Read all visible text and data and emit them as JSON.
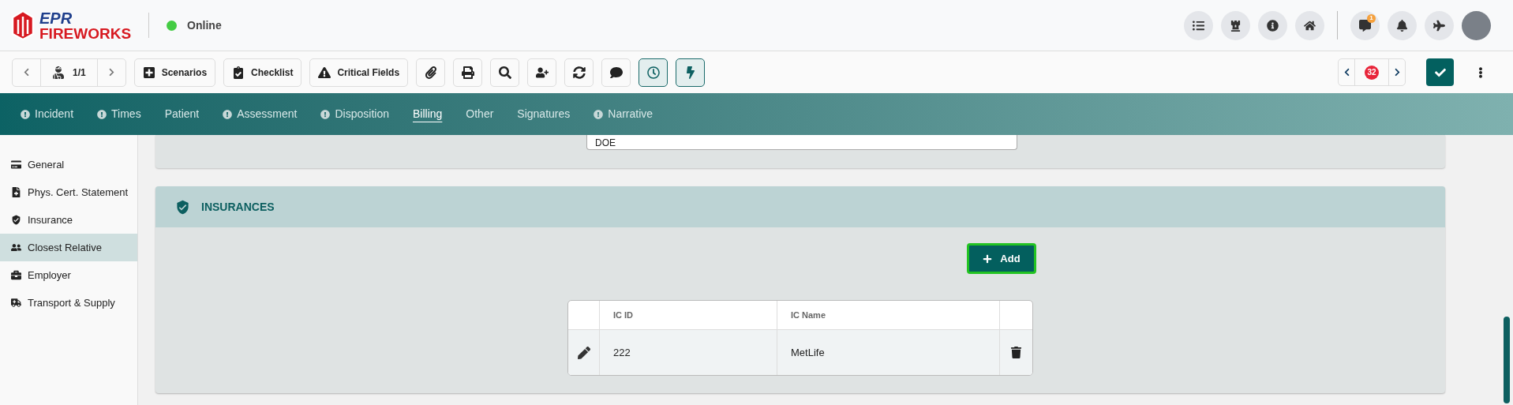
{
  "header": {
    "logo": {
      "top": "EPR",
      "bottom": "FIREWORKS"
    },
    "status": {
      "label": "Online",
      "online": true
    },
    "notification_badge": "1"
  },
  "toolbar": {
    "record_counter": "1/1",
    "buttons": [
      {
        "label": "Scenarios"
      },
      {
        "label": "Checklist"
      },
      {
        "label": "Critical Fields"
      }
    ],
    "icon_buttons": [
      {
        "active": false
      },
      {
        "active": false
      },
      {
        "active": false
      },
      {
        "active": false
      },
      {
        "active": false
      },
      {
        "active": false
      },
      {
        "active": true
      },
      {
        "active": true
      }
    ],
    "pager_badge": "32"
  },
  "tabs": [
    {
      "label": "Incident",
      "alert": true,
      "selected": false
    },
    {
      "label": "Times",
      "alert": true,
      "selected": false
    },
    {
      "label": "Patient",
      "alert": false,
      "selected": false
    },
    {
      "label": "Assessment",
      "alert": true,
      "selected": false
    },
    {
      "label": "Disposition",
      "alert": true,
      "selected": false
    },
    {
      "label": "Billing",
      "alert": false,
      "selected": true
    },
    {
      "label": "Other",
      "alert": false,
      "selected": false
    },
    {
      "label": "Signatures",
      "alert": false,
      "selected": false
    },
    {
      "label": "Narrative",
      "alert": true,
      "selected": false
    }
  ],
  "sidebar": {
    "items": [
      {
        "label": "General",
        "selected": false
      },
      {
        "label": "Phys. Cert. Statement",
        "selected": false
      },
      {
        "label": "Insurance",
        "selected": false
      },
      {
        "label": "Closest Relative",
        "selected": true
      },
      {
        "label": "Employer",
        "selected": false
      },
      {
        "label": "Transport & Supply",
        "selected": false
      }
    ]
  },
  "previous_card": {
    "field_value": "DOE"
  },
  "insurances": {
    "title": "INSURANCES",
    "add_button": "Add",
    "table": {
      "columns": [
        "IC ID",
        "IC Name"
      ],
      "rows": [
        {
          "ic_id": "222",
          "ic_name": "MetLife"
        }
      ]
    }
  }
}
